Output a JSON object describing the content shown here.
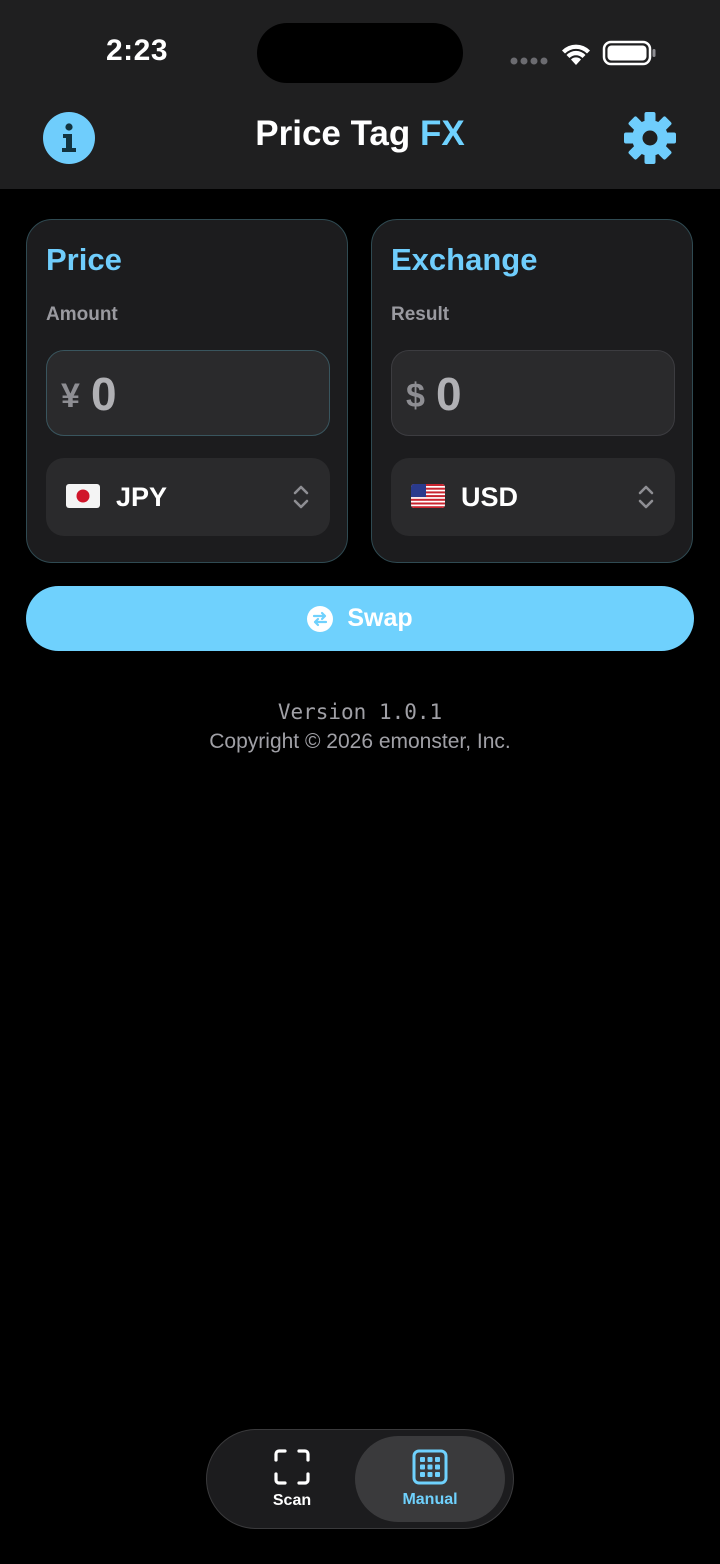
{
  "status": {
    "time": "2:23"
  },
  "header": {
    "title_main": "Price Tag",
    "title_accent": "FX"
  },
  "price_card": {
    "title": "Price",
    "label": "Amount",
    "symbol": "¥",
    "value": "0",
    "currency": "JPY"
  },
  "exchange_card": {
    "title": "Exchange",
    "label": "Result",
    "symbol": "$",
    "value": "0",
    "currency": "USD"
  },
  "swap": {
    "label": "Swap"
  },
  "footer": {
    "version": "Version 1.0.1",
    "copyright": "Copyright © 2026 emonster, Inc."
  },
  "tabs": [
    {
      "label": "Scan",
      "icon": "scan-frame-icon"
    },
    {
      "label": "Manual",
      "icon": "keypad-grid-icon"
    }
  ],
  "colors": {
    "accent": "#6fd1fd",
    "background": "#000000",
    "card": "#1c1c1e"
  }
}
